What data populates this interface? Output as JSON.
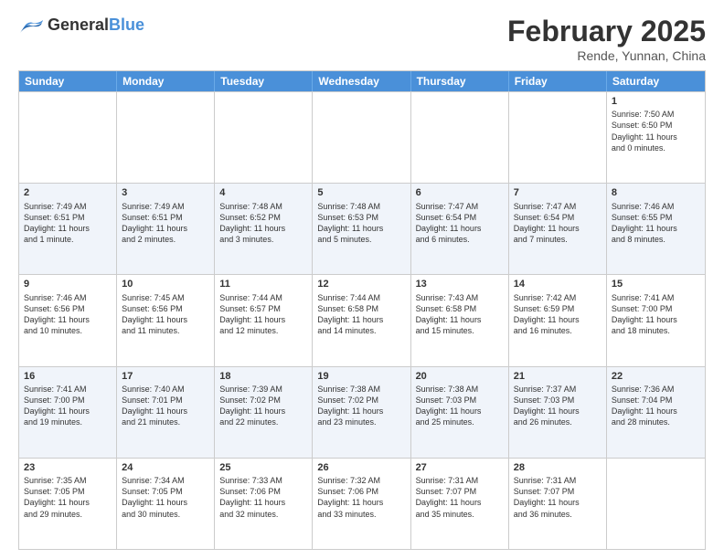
{
  "logo": {
    "general": "General",
    "blue": "Blue"
  },
  "title": "February 2025",
  "subtitle": "Rende, Yunnan, China",
  "weekdays": [
    "Sunday",
    "Monday",
    "Tuesday",
    "Wednesday",
    "Thursday",
    "Friday",
    "Saturday"
  ],
  "weeks": [
    {
      "alt": false,
      "days": [
        {
          "num": "",
          "info": ""
        },
        {
          "num": "",
          "info": ""
        },
        {
          "num": "",
          "info": ""
        },
        {
          "num": "",
          "info": ""
        },
        {
          "num": "",
          "info": ""
        },
        {
          "num": "",
          "info": ""
        },
        {
          "num": "1",
          "info": "Sunrise: 7:50 AM\nSunset: 6:50 PM\nDaylight: 11 hours\nand 0 minutes."
        }
      ]
    },
    {
      "alt": true,
      "days": [
        {
          "num": "2",
          "info": "Sunrise: 7:49 AM\nSunset: 6:51 PM\nDaylight: 11 hours\nand 1 minute."
        },
        {
          "num": "3",
          "info": "Sunrise: 7:49 AM\nSunset: 6:51 PM\nDaylight: 11 hours\nand 2 minutes."
        },
        {
          "num": "4",
          "info": "Sunrise: 7:48 AM\nSunset: 6:52 PM\nDaylight: 11 hours\nand 3 minutes."
        },
        {
          "num": "5",
          "info": "Sunrise: 7:48 AM\nSunset: 6:53 PM\nDaylight: 11 hours\nand 5 minutes."
        },
        {
          "num": "6",
          "info": "Sunrise: 7:47 AM\nSunset: 6:54 PM\nDaylight: 11 hours\nand 6 minutes."
        },
        {
          "num": "7",
          "info": "Sunrise: 7:47 AM\nSunset: 6:54 PM\nDaylight: 11 hours\nand 7 minutes."
        },
        {
          "num": "8",
          "info": "Sunrise: 7:46 AM\nSunset: 6:55 PM\nDaylight: 11 hours\nand 8 minutes."
        }
      ]
    },
    {
      "alt": false,
      "days": [
        {
          "num": "9",
          "info": "Sunrise: 7:46 AM\nSunset: 6:56 PM\nDaylight: 11 hours\nand 10 minutes."
        },
        {
          "num": "10",
          "info": "Sunrise: 7:45 AM\nSunset: 6:56 PM\nDaylight: 11 hours\nand 11 minutes."
        },
        {
          "num": "11",
          "info": "Sunrise: 7:44 AM\nSunset: 6:57 PM\nDaylight: 11 hours\nand 12 minutes."
        },
        {
          "num": "12",
          "info": "Sunrise: 7:44 AM\nSunset: 6:58 PM\nDaylight: 11 hours\nand 14 minutes."
        },
        {
          "num": "13",
          "info": "Sunrise: 7:43 AM\nSunset: 6:58 PM\nDaylight: 11 hours\nand 15 minutes."
        },
        {
          "num": "14",
          "info": "Sunrise: 7:42 AM\nSunset: 6:59 PM\nDaylight: 11 hours\nand 16 minutes."
        },
        {
          "num": "15",
          "info": "Sunrise: 7:41 AM\nSunset: 7:00 PM\nDaylight: 11 hours\nand 18 minutes."
        }
      ]
    },
    {
      "alt": true,
      "days": [
        {
          "num": "16",
          "info": "Sunrise: 7:41 AM\nSunset: 7:00 PM\nDaylight: 11 hours\nand 19 minutes."
        },
        {
          "num": "17",
          "info": "Sunrise: 7:40 AM\nSunset: 7:01 PM\nDaylight: 11 hours\nand 21 minutes."
        },
        {
          "num": "18",
          "info": "Sunrise: 7:39 AM\nSunset: 7:02 PM\nDaylight: 11 hours\nand 22 minutes."
        },
        {
          "num": "19",
          "info": "Sunrise: 7:38 AM\nSunset: 7:02 PM\nDaylight: 11 hours\nand 23 minutes."
        },
        {
          "num": "20",
          "info": "Sunrise: 7:38 AM\nSunset: 7:03 PM\nDaylight: 11 hours\nand 25 minutes."
        },
        {
          "num": "21",
          "info": "Sunrise: 7:37 AM\nSunset: 7:03 PM\nDaylight: 11 hours\nand 26 minutes."
        },
        {
          "num": "22",
          "info": "Sunrise: 7:36 AM\nSunset: 7:04 PM\nDaylight: 11 hours\nand 28 minutes."
        }
      ]
    },
    {
      "alt": false,
      "days": [
        {
          "num": "23",
          "info": "Sunrise: 7:35 AM\nSunset: 7:05 PM\nDaylight: 11 hours\nand 29 minutes."
        },
        {
          "num": "24",
          "info": "Sunrise: 7:34 AM\nSunset: 7:05 PM\nDaylight: 11 hours\nand 30 minutes."
        },
        {
          "num": "25",
          "info": "Sunrise: 7:33 AM\nSunset: 7:06 PM\nDaylight: 11 hours\nand 32 minutes."
        },
        {
          "num": "26",
          "info": "Sunrise: 7:32 AM\nSunset: 7:06 PM\nDaylight: 11 hours\nand 33 minutes."
        },
        {
          "num": "27",
          "info": "Sunrise: 7:31 AM\nSunset: 7:07 PM\nDaylight: 11 hours\nand 35 minutes."
        },
        {
          "num": "28",
          "info": "Sunrise: 7:31 AM\nSunset: 7:07 PM\nDaylight: 11 hours\nand 36 minutes."
        },
        {
          "num": "",
          "info": ""
        }
      ]
    }
  ]
}
